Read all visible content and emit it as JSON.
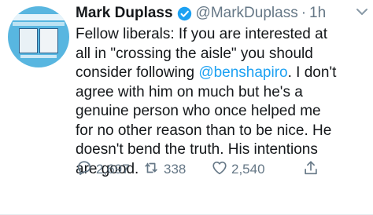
{
  "author": {
    "name": "Mark Duplass",
    "handle": "@MarkDuplass",
    "separator": "·",
    "time": "1h",
    "verified": true
  },
  "tweet": {
    "lines": [
      {
        "pre": "Fellow liberals: If you are interested at",
        "mention": "",
        "post": ""
      },
      {
        "pre": "all in \"crossing the aisle\" you should",
        "mention": "",
        "post": ""
      },
      {
        "pre": "consider following ",
        "mention": "@benshapiro",
        "post": ". I don't"
      },
      {
        "pre": "agree with him on much but he's a",
        "mention": "",
        "post": ""
      },
      {
        "pre": "genuine person who once helped me",
        "mention": "",
        "post": ""
      },
      {
        "pre": "for no other reason than to be nice. He",
        "mention": "",
        "post": ""
      },
      {
        "pre": "doesn't bend the truth. His intentions",
        "mention": "",
        "post": ""
      },
      {
        "pre": "are good.",
        "mention": "",
        "post": ""
      }
    ]
  },
  "actions": {
    "replies": "2,697",
    "retweets": "338",
    "likes": "2,540"
  },
  "icons": {
    "verified": "verified-badge-icon",
    "reply": "reply-icon",
    "retweet": "retweet-icon",
    "like": "heart-icon",
    "share": "share-icon",
    "menu": "chevron-down-icon"
  },
  "colors": {
    "text": "#14171a",
    "muted": "#657786",
    "accent": "#1da1f2",
    "avatar_bg": "#58b6e0"
  }
}
